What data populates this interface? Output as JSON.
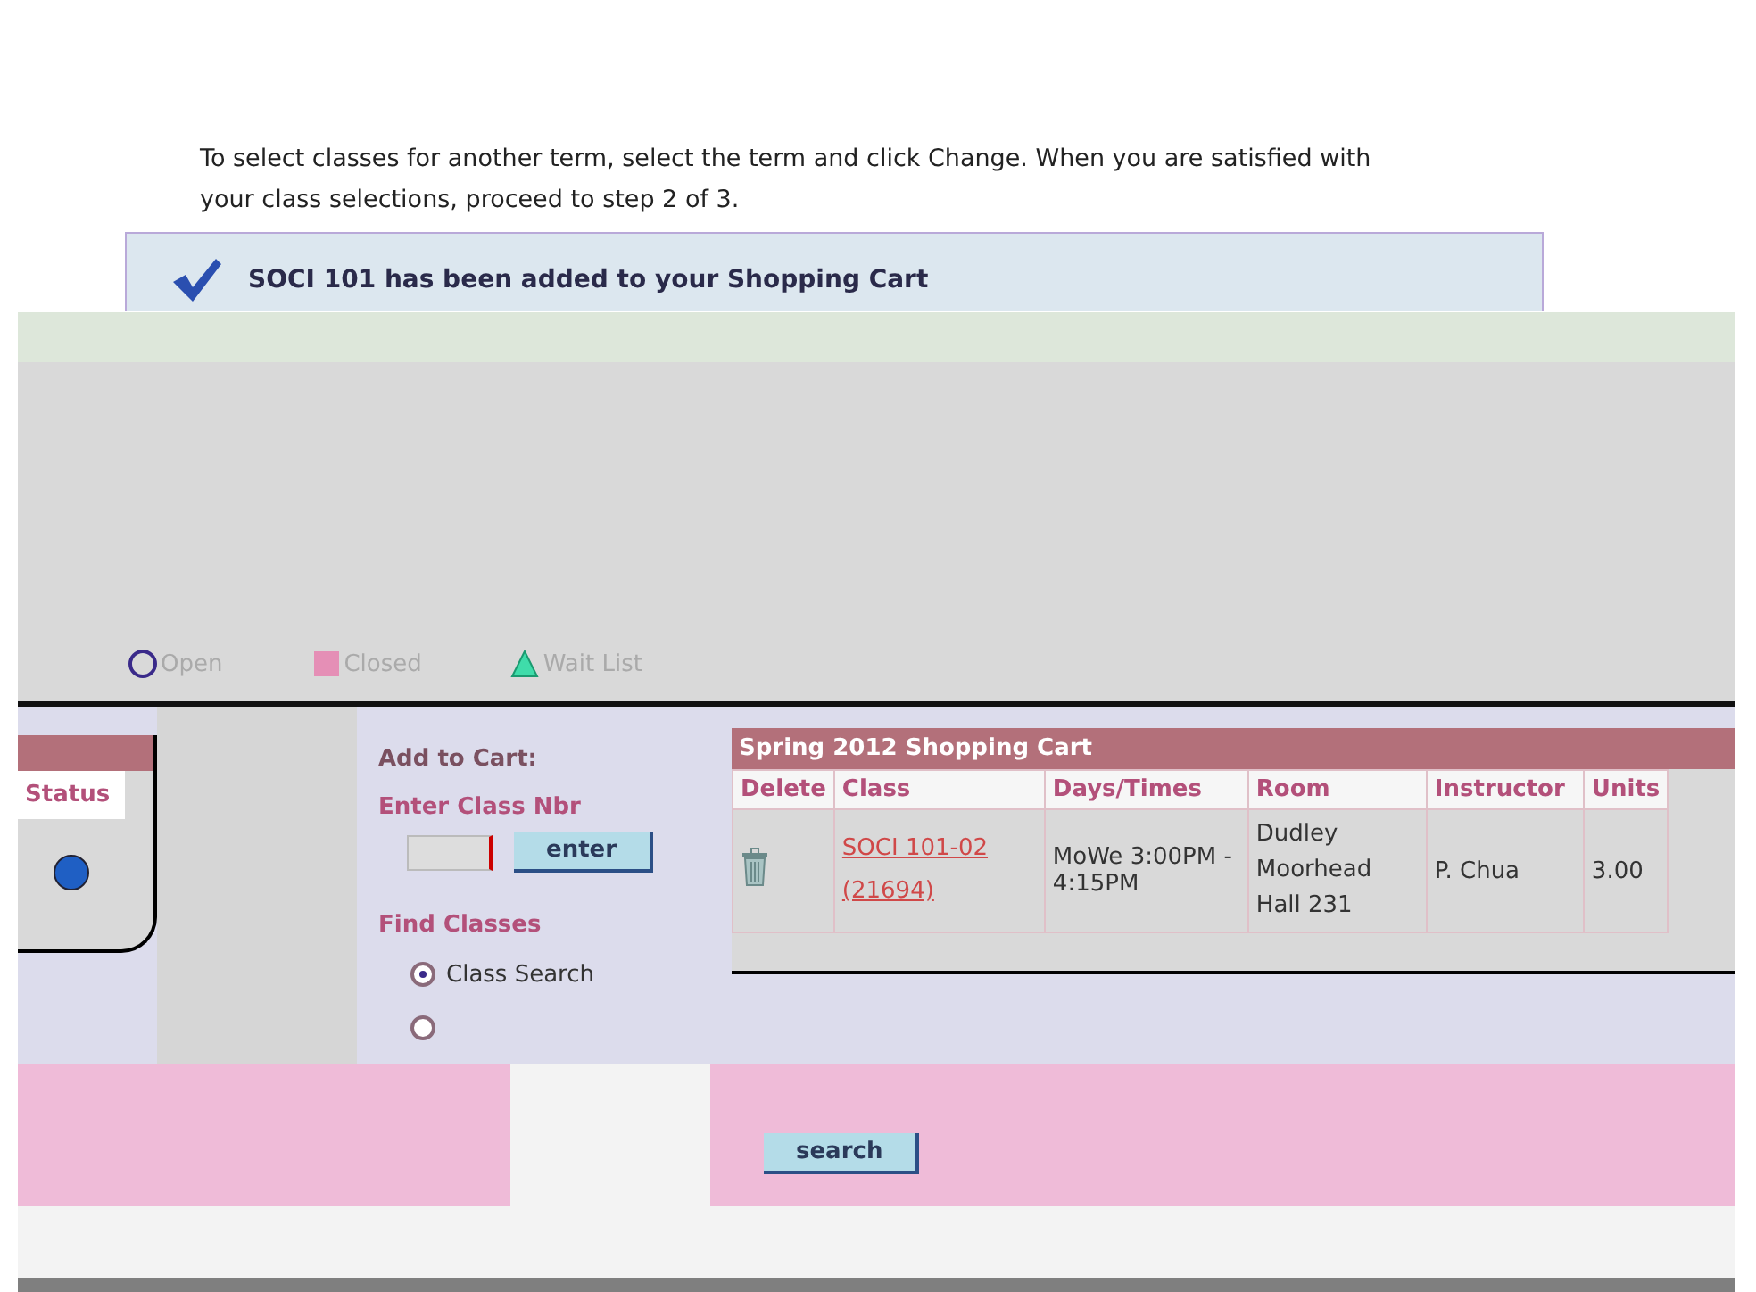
{
  "instructions": "To select classes for another term, select the term and click Change.  When you are satisfied with your class selections, proceed to step 2 of 3.",
  "message": {
    "text": "SOCI 101 has been added to your Shopping Cart"
  },
  "legend": [
    {
      "kind": "circle",
      "label": "Open"
    },
    {
      "kind": "square",
      "label": "Closed"
    },
    {
      "kind": "triangle",
      "label": "Wait List"
    }
  ],
  "results": {
    "column": "Status",
    "color": "#1f5fc4"
  },
  "add_to_cart": {
    "title": "Add to Cart:",
    "enter_label": "Enter Class Nbr",
    "enter_button": "enter",
    "find_label": "Find Classes",
    "options": [
      {
        "label": "Class Search",
        "selected": true
      },
      {
        "selected": false
      }
    ],
    "search_button": "search"
  },
  "cart": {
    "title": "Spring 2012 Shopping Cart",
    "columns": [
      "Delete",
      "Class",
      "Days/Times",
      "Room",
      "Instructor",
      "Units"
    ],
    "rows": [
      {
        "class": "SOCI 101-02 (21694)",
        "days_times": "MoWe 3:00PM - 4:15PM",
        "room": "Dudley Moorhead Hall 231",
        "instructor": "P. Chua",
        "units": "3.00"
      }
    ]
  }
}
